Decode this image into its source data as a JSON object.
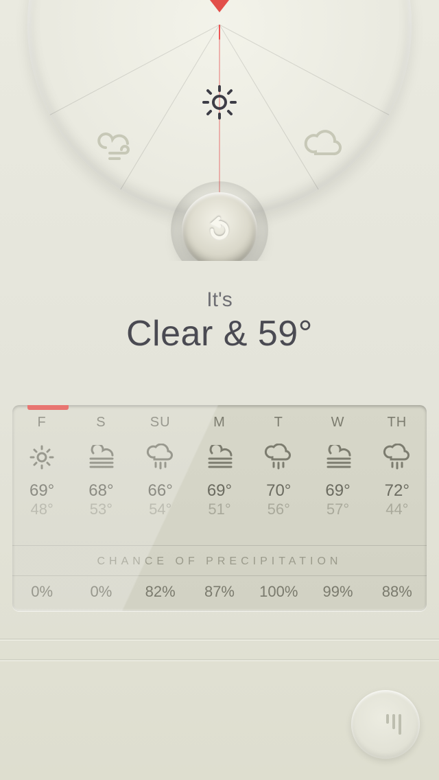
{
  "dial": {
    "center_icon": "sun-icon",
    "left_icon": "wind-cloud-icon",
    "right_icon": "cloud-icon",
    "refresh_label": "refresh"
  },
  "headline": {
    "prefix": "It's",
    "condition": "Clear & 59°"
  },
  "forecast": {
    "precip_header": "CHANCE OF PRECIPITATION",
    "days": [
      {
        "label": "F",
        "icon": "sun",
        "hi": "69°",
        "lo": "48°",
        "precip": "0%"
      },
      {
        "label": "S",
        "icon": "fog",
        "hi": "68°",
        "lo": "53°",
        "precip": "0%"
      },
      {
        "label": "SU",
        "icon": "rain",
        "hi": "66°",
        "lo": "54°",
        "precip": "82%"
      },
      {
        "label": "M",
        "icon": "fog",
        "hi": "69°",
        "lo": "51°",
        "precip": "87%"
      },
      {
        "label": "T",
        "icon": "rain",
        "hi": "70°",
        "lo": "56°",
        "precip": "100%"
      },
      {
        "label": "W",
        "icon": "fog",
        "hi": "69°",
        "lo": "57°",
        "precip": "99%"
      },
      {
        "label": "TH",
        "icon": "rain",
        "hi": "72°",
        "lo": "44°",
        "precip": "88%"
      }
    ]
  },
  "colors": {
    "accent": "#e24e49",
    "text_dark": "#4a4a52",
    "text_mid": "#7c7c6f",
    "text_light": "#a9a99b"
  }
}
